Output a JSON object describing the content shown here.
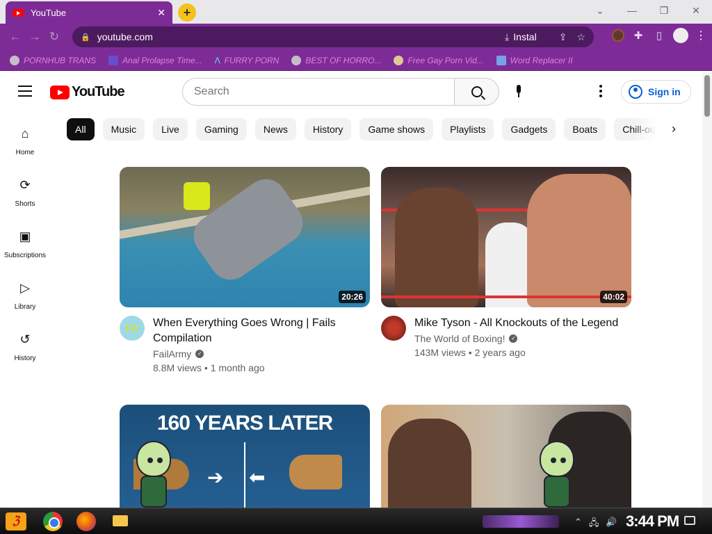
{
  "browser": {
    "tab": {
      "title": "YouTube",
      "close": "✕"
    },
    "new_tab": "+",
    "window_controls": {
      "collapse": "⌄",
      "minimize": "—",
      "restore": "❐",
      "close": "✕"
    },
    "nav": {
      "back": "←",
      "forward": "→",
      "reload": "↻"
    },
    "address": {
      "url": "youtube.com",
      "install_label": "Instal"
    },
    "bookmarks": [
      {
        "label": "PORNHUB TRANS",
        "icon": "globe-icon"
      },
      {
        "label": "Anal Prolapse Time...",
        "icon": "bookmark-icon"
      },
      {
        "label": "FURRY PORN",
        "icon": "lambda-icon"
      },
      {
        "label": "BEST OF HORRO...",
        "icon": "globe-icon"
      },
      {
        "label": "Free Gay Porn Vid...",
        "icon": "bookmark-icon"
      },
      {
        "label": "Word Replacer II",
        "icon": "wr-icon"
      }
    ]
  },
  "youtube": {
    "logo_text": "YouTube",
    "search": {
      "placeholder": "Search"
    },
    "sign_in": "Sign in",
    "sidebar": [
      {
        "label": "Home",
        "icon": "⌂"
      },
      {
        "label": "Shorts",
        "icon": "⟳"
      },
      {
        "label": "Subscriptions",
        "icon": "▣"
      },
      {
        "label": "Library",
        "icon": "▷"
      },
      {
        "label": "History",
        "icon": "↺"
      }
    ],
    "chips": [
      "All",
      "Music",
      "Live",
      "Gaming",
      "News",
      "History",
      "Game shows",
      "Playlists",
      "Gadgets",
      "Boats",
      "Chill-out"
    ],
    "chips_next": "›",
    "videos": [
      {
        "title": "When Everything Goes Wrong | Fails Compilation",
        "channel": "FailArmy",
        "stats": "8.8M views • 1 month ago",
        "duration": "20:26",
        "avatar_text": "FA"
      },
      {
        "title": "Mike Tyson - All Knockouts of the Legend",
        "channel": "The World of Boxing!",
        "stats": "143M views • 2 years ago",
        "duration": "40:02",
        "avatar_text": ""
      },
      {
        "title": "",
        "channel": "",
        "stats": "",
        "duration": "",
        "headline": "160 YEARS LATER"
      },
      {
        "title": "",
        "channel": "",
        "stats": "",
        "duration": ""
      }
    ]
  },
  "taskbar": {
    "clock": "3:44 PM"
  },
  "colors": {
    "browser_theme": "#7d2c97",
    "yt_red": "#ff0000",
    "link_blue": "#065fd4",
    "chip_active": "#0f0f0f"
  }
}
